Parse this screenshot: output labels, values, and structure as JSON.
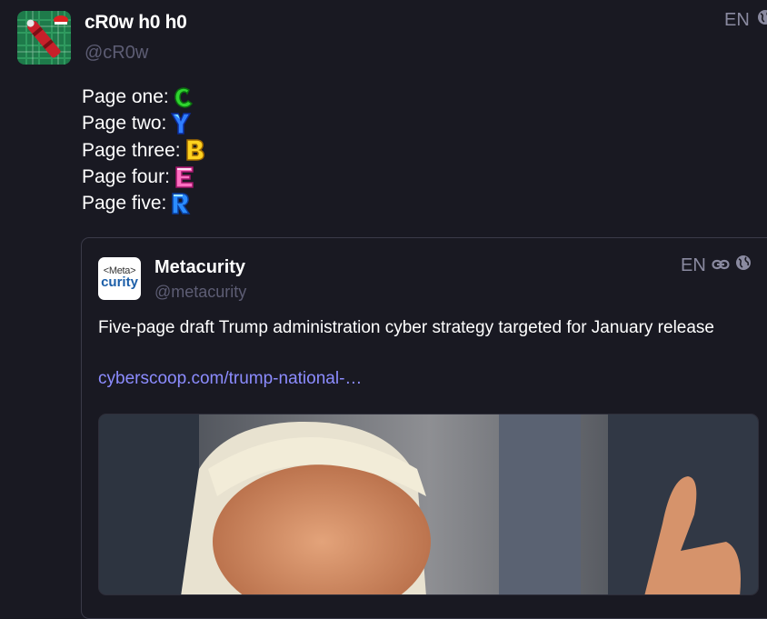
{
  "post": {
    "display_name": "cR0w h0 h0",
    "handle": "@cR0w",
    "language": "EN",
    "icons": [
      "globe-icon"
    ],
    "lines": [
      {
        "text": "Page one:",
        "emoji": "C",
        "emoji_color": "#2fd32f"
      },
      {
        "text": "Page two:",
        "emoji": "Y",
        "emoji_color": "#2f7dff"
      },
      {
        "text": "Page three:",
        "emoji": "B",
        "emoji_color": "#ffd21f"
      },
      {
        "text": "Page four:",
        "emoji": "E",
        "emoji_color": "#ff6fc1"
      },
      {
        "text": "Page five:",
        "emoji": "R",
        "emoji_color": "#2a8cff"
      }
    ]
  },
  "quote": {
    "avatar_line1": "<Meta>",
    "avatar_line2": "curity",
    "display_name": "Metacurity",
    "handle": "@metacurity",
    "language": "EN",
    "icons": [
      "link-icon",
      "globe-icon"
    ],
    "text": "Five-page draft Trump administration cyber strategy targeted for January release",
    "link": "cyberscoop.com/trump-national-…"
  },
  "colors": {
    "background": "#191922",
    "muted": "#5d5d74",
    "link": "#8c8cff",
    "border": "#3a3a48"
  }
}
